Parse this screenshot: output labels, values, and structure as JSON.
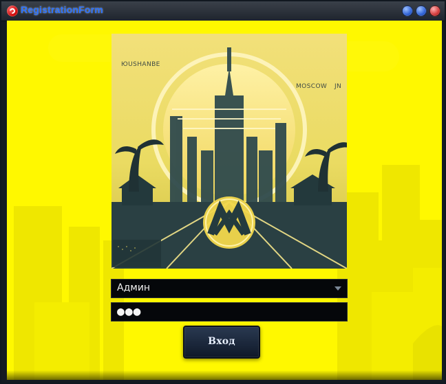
{
  "window": {
    "title": "RegistrationForm"
  },
  "hero": {
    "label_left": "ЮUSHANBE",
    "label_right": "MOSCOW",
    "label_right_extra": "JN"
  },
  "form": {
    "username_value": "Админ",
    "password_masked": "●●●"
  },
  "actions": {
    "login_label": "Вход"
  },
  "theme": {
    "background_yellow": "#fff800",
    "button_dark": "#0f1828",
    "field_black": "#05070a",
    "title_blue": "#2a72ff"
  }
}
